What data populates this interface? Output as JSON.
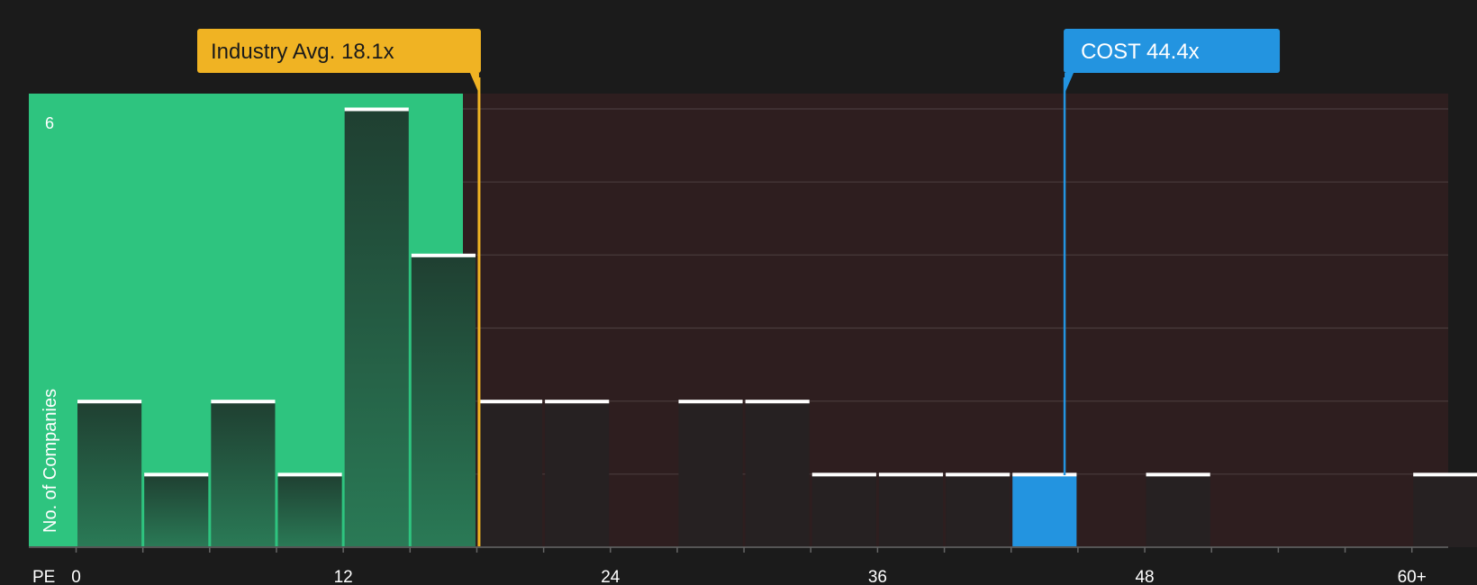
{
  "chart_data": {
    "type": "bar",
    "x_axis_prefix": "PE",
    "ylabel": "No. of Companies",
    "ylim": [
      0,
      6
    ],
    "y_tick_shown": "6",
    "xlim": [
      0,
      61.5
    ],
    "bin_width": 3,
    "x_ticks": [
      {
        "value": 0,
        "label": "0"
      },
      {
        "value": 12,
        "label": "12"
      },
      {
        "value": 24,
        "label": "24"
      },
      {
        "value": 36,
        "label": "36"
      },
      {
        "value": 48,
        "label": "48"
      },
      {
        "value": 60,
        "label": "60+"
      }
    ],
    "bins": [
      {
        "start": 0,
        "count": 2
      },
      {
        "start": 3,
        "count": 1
      },
      {
        "start": 6,
        "count": 2
      },
      {
        "start": 9,
        "count": 1
      },
      {
        "start": 12,
        "count": 6
      },
      {
        "start": 15,
        "count": 4
      },
      {
        "start": 18,
        "count": 2
      },
      {
        "start": 21,
        "count": 2
      },
      {
        "start": 27,
        "count": 2
      },
      {
        "start": 30,
        "count": 2
      },
      {
        "start": 33,
        "count": 1
      },
      {
        "start": 36,
        "count": 1
      },
      {
        "start": 39,
        "count": 1
      },
      {
        "start": 42,
        "count": 1,
        "highlight": true
      },
      {
        "start": 48,
        "count": 1
      },
      {
        "start": 60,
        "count": 1
      }
    ],
    "industry_avg": {
      "value": 18.1,
      "label": "Industry Avg. 18.1x"
    },
    "company": {
      "value": 44.4,
      "label": "COST 44.4x"
    },
    "colors": {
      "background": "#1b1b1b",
      "below_region": "#2ec47f",
      "above_region": "#2e1e1f",
      "bar_below": "#1f4a36",
      "bar_above": "#262122",
      "bar_highlight": "#2394e0",
      "industry_accent": "#f0b323",
      "company_accent": "#2394e0"
    }
  }
}
